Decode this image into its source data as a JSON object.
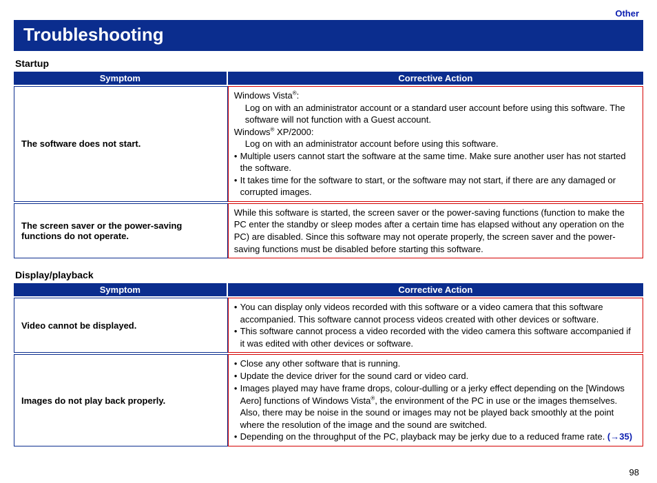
{
  "header": {
    "breadcrumb": "Other",
    "title": "Troubleshooting"
  },
  "page_number": "98",
  "sections": [
    {
      "heading": "Startup",
      "columns": {
        "symptom": "Symptom",
        "action": "Corrective Action"
      },
      "rows": [
        {
          "symptom": "The software does not start.",
          "action_html": "Windows Vista<span class='sup'>®</span>:<span class='indent'>Log on with an administrator account or a standard user account before using this software. The software will not function with a Guest account.</span>Windows<span class='sup'>®</span> XP/2000:<span class='indent'>Log on with an administrator account before using this software.</span><div class='bullet'><span>Multiple users cannot start the software at the same time. Make sure another user has not started the software.</span></div><div class='bullet'><span>It takes time for the software to start, or the software may not start, if there are any damaged or corrupted images.</span></div>"
        },
        {
          "symptom": "The screen saver or the power-saving functions do not operate.",
          "action_html": "While this software is started, the screen saver or the power-saving functions (function to make the PC enter the standby or sleep modes after a certain time has elapsed without any operation on the PC) are disabled. Since this software may not operate properly, the screen saver and the power-saving functions must be disabled before starting this software."
        }
      ]
    },
    {
      "heading": "Display/playback",
      "columns": {
        "symptom": "Symptom",
        "action": "Corrective Action"
      },
      "rows": [
        {
          "symptom": "Video cannot be displayed.",
          "action_html": "<div class='bullet'><span>You can display only videos recorded with this software or a video camera that this software accompanied. This software cannot process videos created with other devices or software.</span></div><div class='bullet'><span>This software cannot process a video recorded with the video camera this software accompanied if it was edited with other devices or software.</span></div>"
        },
        {
          "symptom": "Images do not play back properly.",
          "action_html": "<div class='bullet'><span>Close any other software that is running.</span></div><div class='bullet'><span>Update the device driver for the sound card or video card.</span></div><div class='bullet'><span>Images played may have frame drops, colour-dulling or a jerky effect depending on the [Windows Aero] functions of Windows Vista<span class='sup'>®</span>, the environment of the PC in use or the images themselves. Also, there may be noise in the sound or images may not be played back smoothly at the point where the resolution of the image and the sound are switched.</span></div><div class='bullet'><span>Depending on the throughput of the PC, playback may be jerky due to a reduced frame rate. <span class='link'>(→35)</span></span></div>"
        }
      ]
    }
  ]
}
